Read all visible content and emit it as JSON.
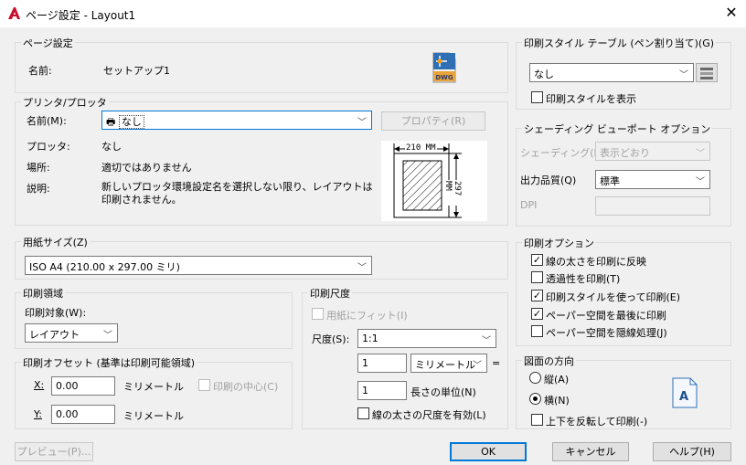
{
  "window": {
    "title": "ページ設定 - Layout1",
    "close_glyph": "✕"
  },
  "page_setup": {
    "group_label": "ページ設定",
    "name_label": "名前:",
    "name_value": "セットアップ1",
    "dwg_icon_text": "DWG"
  },
  "printer": {
    "group_label": "プリンタ/プロッタ",
    "name_label": "名前(M):",
    "name_value": "なし",
    "properties_button": "プロパティ(R)",
    "plotter_label": "プロッタ:",
    "plotter_value": "なし",
    "location_label": "場所:",
    "location_value": "適切ではありません",
    "description_label": "説明:",
    "description_value": "新しいプロッタ環境設定名を選択しない限り、レイアウトは印刷されません。",
    "preview_width": "210 MM",
    "preview_height": "297 MM"
  },
  "paper_size": {
    "group_label": "用紙サイズ(Z)",
    "value": "ISO A4 (210.00 x 297.00 ミリ)"
  },
  "plot_area": {
    "group_label": "印刷領域",
    "target_label": "印刷対象(W):",
    "target_value": "レイアウト"
  },
  "plot_offset": {
    "group_label": "印刷オフセット (基準は印刷可能領域)",
    "x_label": "X:",
    "x_value": "0.00",
    "x_unit": "ミリメートル",
    "y_label": "Y:",
    "y_value": "0.00",
    "y_unit": "ミリメートル",
    "center_label": "印刷の中心(C)"
  },
  "plot_scale": {
    "group_label": "印刷尺度",
    "fit_label": "用紙にフィット(I)",
    "scale_label": "尺度(S):",
    "scale_value": "1:1",
    "units_value_1": "1",
    "units_select": "ミリメートル",
    "equals": "=",
    "units_value_2": "1",
    "unit_length_label": "長さの単位(N)",
    "scale_lineweights_label": "線の太さの尺度を有効(L)"
  },
  "plot_style_table": {
    "group_label": "印刷スタイル テーブル (ペン割り当て)(G)",
    "value": "なし",
    "show_label": "印刷スタイルを表示"
  },
  "shaded_viewport": {
    "group_label": "シェーディング ビューポート オプション",
    "shade_label": "シェーディング(D)",
    "shade_value": "表示どおり",
    "quality_label": "出力品質(Q)",
    "quality_value": "標準",
    "dpi_label": "DPI"
  },
  "plot_options": {
    "group_label": "印刷オプション",
    "items": [
      {
        "label": "線の太さを印刷に反映",
        "checked": true
      },
      {
        "label": "透過性を印刷(T)",
        "checked": false
      },
      {
        "label": "印刷スタイルを使って印刷(E)",
        "checked": true
      },
      {
        "label": "ペーパー空間を最後に印刷",
        "checked": true
      },
      {
        "label": "ペーパー空間を隠線処理(J)",
        "checked": false
      }
    ]
  },
  "orientation": {
    "group_label": "図面の方向",
    "portrait_label": "縦(A)",
    "landscape_label": "横(N)",
    "upside_down_label": "上下を反転して印刷(-)",
    "icon_letter": "A"
  },
  "footer": {
    "preview_button": "プレビュー(P)...",
    "ok_button": "OK",
    "cancel_button": "キャンセル",
    "help_button": "ヘルプ(H)"
  },
  "colors": {
    "app_red": "#c8102e",
    "focus_blue": "#0078d7"
  },
  "icons": {
    "app": "autocad-a-icon",
    "printer": "printer-icon",
    "dwg_file": "dwg-file-icon",
    "style_edit": "plot-style-edit-icon",
    "landscape": "landscape-orientation-icon"
  }
}
